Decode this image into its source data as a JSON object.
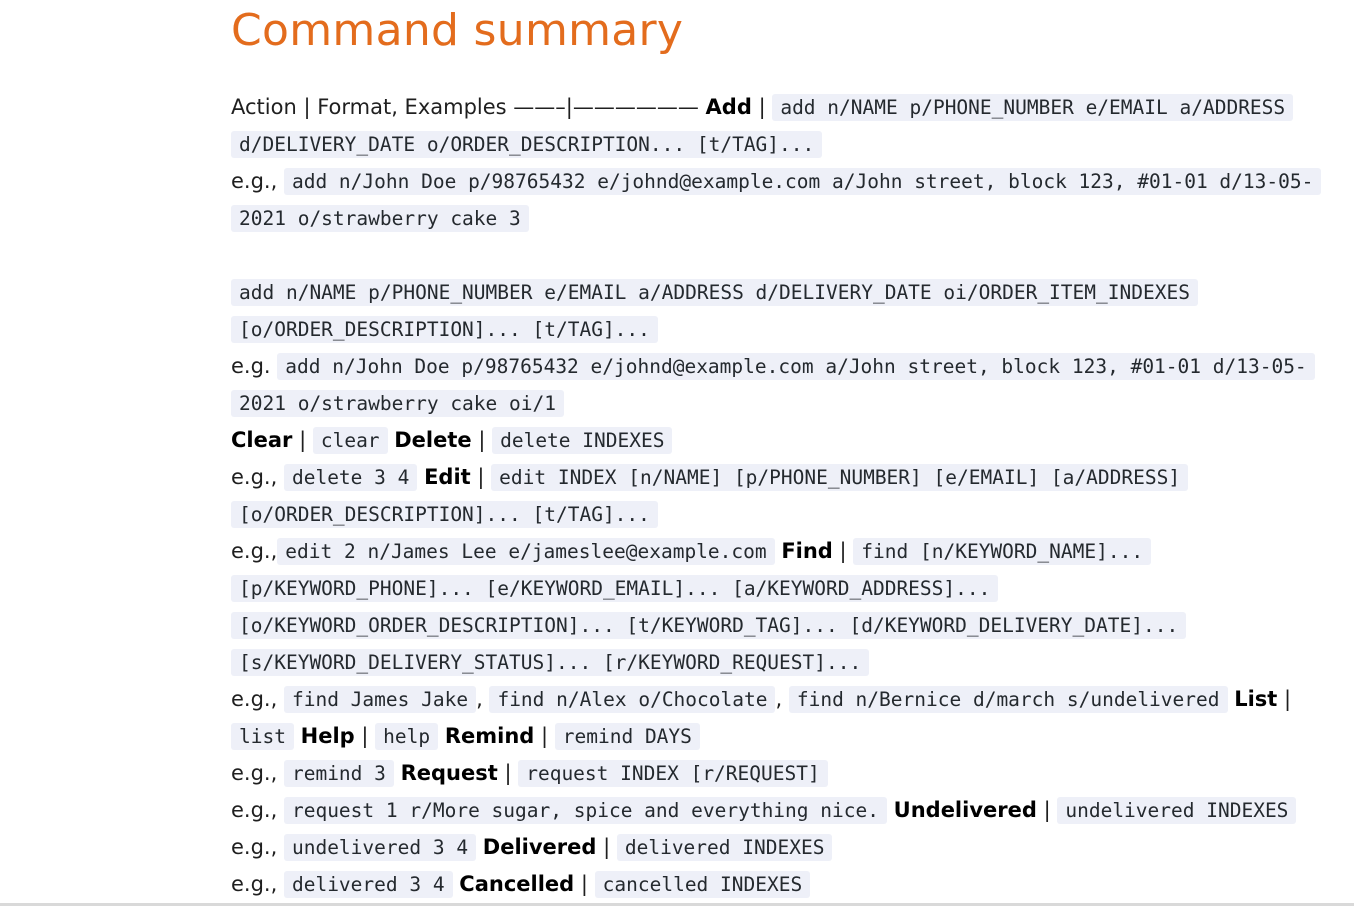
{
  "heading": "Command summary",
  "table_header": "Action | Format, Examples ——–|——————",
  "add": {
    "name": "Add",
    "format_1": "add n/NAME p/PHONE_NUMBER e/EMAIL a/ADDRESS d/DELIVERY_DATE o/ORDER_DESCRIPTION... [t/TAG]...",
    "eg_label_1": "e.g.,",
    "example_1": "add n/John Doe p/98765432 e/johnd@example.com a/John street, block 123, #01-01 d/13-05-2021 o/strawberry cake 3",
    "format_2": "add n/NAME p/PHONE_NUMBER e/EMAIL a/ADDRESS d/DELIVERY_DATE oi/ORDER_ITEM_INDEXES [o/ORDER_DESCRIPTION]... [t/TAG]...",
    "eg_label_2": "e.g.",
    "example_2": "add n/John Doe p/98765432 e/johnd@example.com a/John street, block 123, #01-01 d/13-05-2021 o/strawberry cake oi/1"
  },
  "clear": {
    "name": "Clear",
    "format": "clear"
  },
  "delete": {
    "name": "Delete",
    "format": "delete INDEXES",
    "eg_label": "e.g.,",
    "example": "delete 3 4"
  },
  "edit": {
    "name": "Edit",
    "format": "edit INDEX [n/NAME] [p/PHONE_NUMBER] [e/EMAIL] [a/ADDRESS] [o/ORDER_DESCRIPTION]... [t/TAG]...",
    "eg_label": "e.g.,",
    "example": "edit 2 n/James Lee e/jameslee@example.com"
  },
  "find": {
    "name": "Find",
    "format": "find [n/KEYWORD_NAME]... [p/KEYWORD_PHONE]... [e/KEYWORD_EMAIL]... [a/KEYWORD_ADDRESS]... [o/KEYWORD_ORDER_DESCRIPTION]... [t/KEYWORD_TAG]... [d/KEYWORD_DELIVERY_DATE]... [s/KEYWORD_DELIVERY_STATUS]... [r/KEYWORD_REQUEST]...",
    "eg_label": "e.g.,",
    "example_1": "find James Jake",
    "example_2": "find n/Alex o/Chocolate",
    "example_3": "find n/Bernice d/march s/undelivered"
  },
  "list": {
    "name": "List",
    "format": "list"
  },
  "help": {
    "name": "Help",
    "format": "help"
  },
  "remind": {
    "name": "Remind",
    "format": "remind DAYS",
    "eg_label": "e.g.,",
    "example": "remind 3"
  },
  "request": {
    "name": "Request",
    "format": "request INDEX [r/REQUEST]",
    "eg_label": "e.g.,",
    "example": "request 1 r/More sugar, spice and everything nice."
  },
  "undelivered": {
    "name": "Undelivered",
    "format": "undelivered INDEXES",
    "eg_label": "e.g.,",
    "example": "undelivered 3 4"
  },
  "delivered": {
    "name": "Delivered",
    "format": "delivered INDEXES",
    "eg_label": "e.g.,",
    "example": "delivered 3 4"
  },
  "cancelled": {
    "name": "Cancelled",
    "format": "cancelled INDEXES"
  },
  "separator": "|",
  "comma": ","
}
